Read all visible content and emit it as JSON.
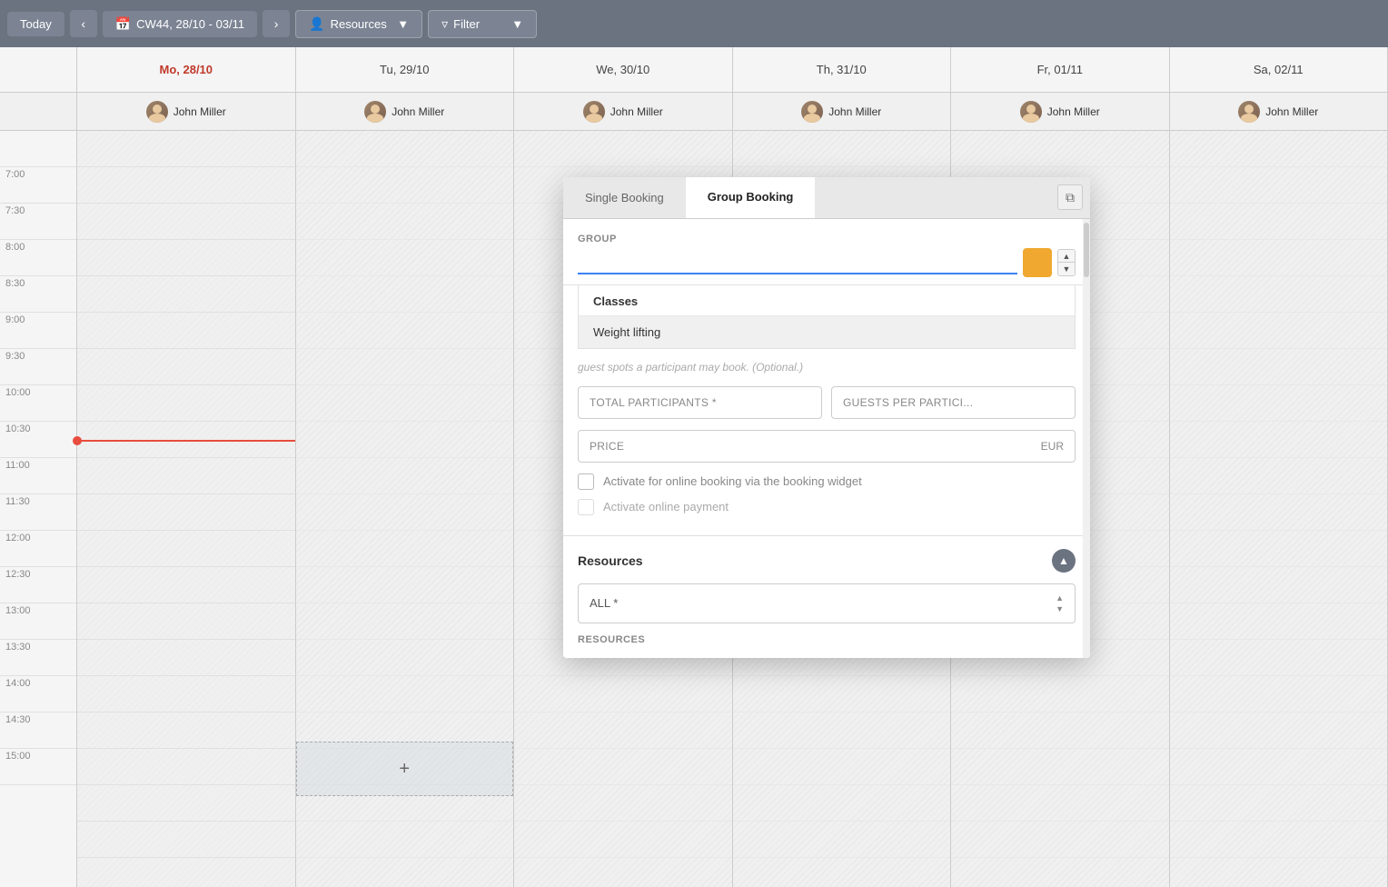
{
  "toolbar": {
    "today_label": "Today",
    "week_label": "CW44, 28/10 - 03/11",
    "resources_label": "Resources",
    "filter_label": "Filter"
  },
  "calendar": {
    "days": [
      {
        "label": "Tu, 29/10",
        "is_today": false
      },
      {
        "label": "We, 30/10",
        "is_today": false
      },
      {
        "label": "Th, 31/10",
        "is_today": false
      },
      {
        "label": "Fr, 01/11",
        "is_today": false
      },
      {
        "label": "Sa, 02/11",
        "is_today": false
      }
    ],
    "resource_name": "John Miller",
    "time_slots": [
      "",
      "",
      "",
      "",
      "",
      "",
      "",
      "",
      "",
      "",
      "",
      "",
      "",
      "",
      "",
      "",
      "",
      "",
      "",
      ""
    ]
  },
  "modal": {
    "tab_single": "Single Booking",
    "tab_group": "Group Booking",
    "active_tab": "group",
    "group_section": {
      "label": "GROUP",
      "input_placeholder": "",
      "input_value": ""
    },
    "dropdown": {
      "category": "Classes",
      "item": "Weight lifting"
    },
    "hint_text": "guest spots a participant may book. (Optional.)",
    "total_participants_placeholder": "TOTAL PARTICIPANTS *",
    "guests_per_placeholder": "GUESTS PER PARTICI...",
    "price_label": "PRICE",
    "price_currency": "EUR",
    "checkbox_online": "Activate for online booking via the booking widget",
    "checkbox_payment": "Activate online payment",
    "resources_section": {
      "title": "Resources",
      "all_label": "ALL *",
      "resources_label": "RESOURCES"
    }
  }
}
